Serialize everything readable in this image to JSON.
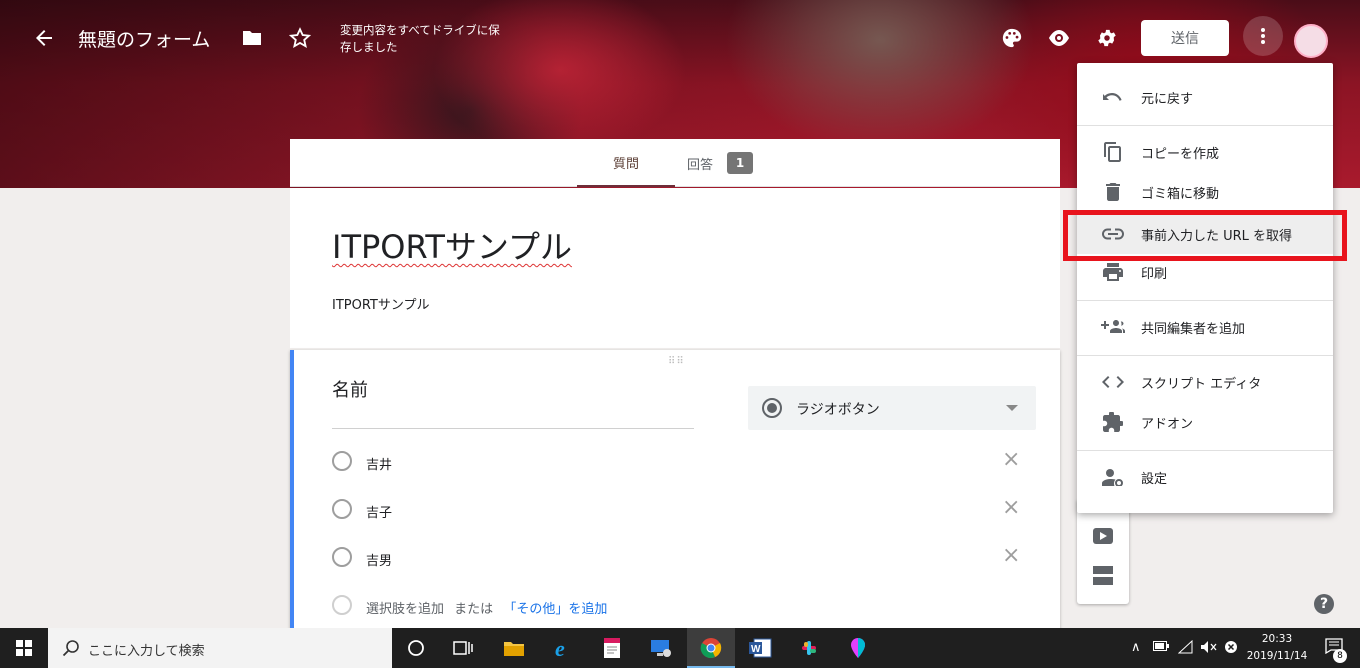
{
  "header": {
    "form_title": "無題のフォーム",
    "save_status": "変更内容をすべてドライブに保存しました",
    "send_label": "送信"
  },
  "tabs": {
    "questions": "質問",
    "responses": "回答",
    "response_count": "1"
  },
  "form": {
    "title": "ITPORTサンプル",
    "description": "ITPORTサンプル"
  },
  "question": {
    "title": "名前",
    "type": "ラジオボタン",
    "options": [
      "吉井",
      "吉子",
      "吉男"
    ],
    "add_option": "選択肢を追加",
    "or": "または",
    "add_other": "「その他」を追加"
  },
  "menu": {
    "items": [
      {
        "label": "元に戻す",
        "icon": "undo-icon"
      },
      {
        "label": "コピーを作成",
        "icon": "copy-icon"
      },
      {
        "label": "ゴミ箱に移動",
        "icon": "trash-icon"
      },
      {
        "label": "事前入力した URL を取得",
        "icon": "link-icon"
      },
      {
        "label": "印刷",
        "icon": "print-icon"
      },
      {
        "label": "共同編集者を追加",
        "icon": "add-people-icon"
      },
      {
        "label": "スクリプト エディタ",
        "icon": "code-icon"
      },
      {
        "label": "アドオン",
        "icon": "puzzle-icon"
      },
      {
        "label": "設定",
        "icon": "person-settings-icon"
      }
    ]
  },
  "taskbar": {
    "search_placeholder": "ここに入力して検索",
    "time": "20:33",
    "date": "2019/11/14",
    "notification_count": "8"
  },
  "colors": {
    "accent_blue": "#4285f4",
    "highlight_red": "#e8141d",
    "tab_active": "#6d2f3a",
    "link_blue": "#1a73e8"
  }
}
